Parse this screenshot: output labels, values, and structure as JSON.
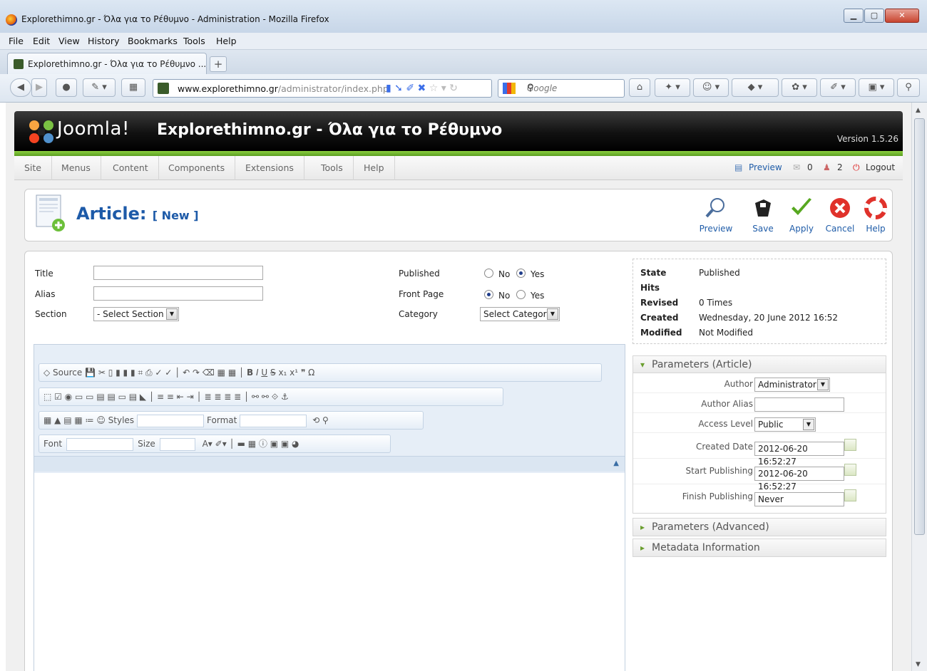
{
  "browser": {
    "window_title": "Explorethimno.gr - Όλα για το Ρέθυμνο - Administration - Mozilla Firefox",
    "menu": [
      "File",
      "Edit",
      "View",
      "History",
      "Bookmarks",
      "Tools",
      "Help"
    ],
    "tab_title": "Explorethimno.gr - Όλα για το Ρέθυμνο ...",
    "url_host": "www.explorethimno.gr",
    "url_path": "/administrator/index.php",
    "search_placeholder": "Google"
  },
  "joomla": {
    "brand": "Joomla!",
    "site_title": "Explorethimno.gr - Όλα για το Ρέθυμνο",
    "version": "Version 1.5.26",
    "menu": [
      "Site",
      "Menus",
      "Content",
      "Components",
      "Extensions",
      "Tools",
      "Help"
    ],
    "status": {
      "preview": "Preview",
      "messages": "0",
      "users": "2",
      "logout": "Logout"
    },
    "page_title": "Article:",
    "page_subtitle": "[ New ]",
    "toolbar": [
      "Preview",
      "Save",
      "Apply",
      "Cancel",
      "Help"
    ]
  },
  "form": {
    "title_label": "Title",
    "alias_label": "Alias",
    "section_label": "Section",
    "section_value": "- Select Section -",
    "published_label": "Published",
    "frontpage_label": "Front Page",
    "category_label": "Category",
    "category_value": "Select Category",
    "no": "No",
    "yes": "Yes",
    "published_selected": "Yes",
    "frontpage_selected": "No"
  },
  "editor": {
    "source": "Source",
    "styles": "Styles",
    "format": "Format",
    "font": "Font",
    "size": "Size"
  },
  "info": {
    "state_label": "State",
    "state_value": "Published",
    "hits_label": "Hits",
    "hits_value": "",
    "revised_label": "Revised",
    "revised_value": "0 Times",
    "created_label": "Created",
    "created_value": "Wednesday, 20 June 2012 16:52",
    "modified_label": "Modified",
    "modified_value": "Not Modified"
  },
  "params": {
    "header": "Parameters (Article)",
    "author_label": "Author",
    "author_value": "Administrator",
    "author_alias_label": "Author Alias",
    "author_alias_value": "",
    "access_label": "Access Level",
    "access_value": "Public",
    "created_date_label": "Created Date",
    "created_date_value": "2012-06-20 16:52:27",
    "start_label": "Start Publishing",
    "start_value": "2012-06-20 16:52:27",
    "finish_label": "Finish Publishing",
    "finish_value": "Never",
    "advanced": "Parameters (Advanced)",
    "metadata": "Metadata Information"
  }
}
